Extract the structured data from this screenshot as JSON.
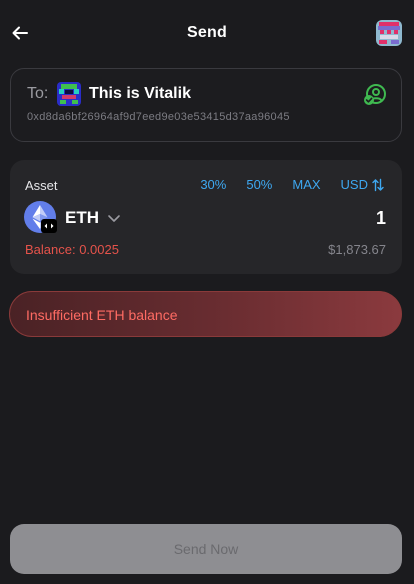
{
  "header": {
    "title": "Send",
    "back_icon": "arrow-left-icon",
    "avatar_icon": "wallet-avatar-icon"
  },
  "recipient": {
    "to_label": "To:",
    "name": "This is Vitalik",
    "address": "0xd8da6bf26964af9d7eed9e03e53415d37aa96045",
    "contact_icon": "contact-check-icon"
  },
  "asset": {
    "label": "Asset",
    "percent_options": [
      "30%",
      "50%",
      "MAX"
    ],
    "currency": "USD",
    "token_symbol": "ETH",
    "amount": "1",
    "balance": "Balance: 0.0025",
    "fiat_value": "$1,873.67"
  },
  "error": {
    "message": "Insufficient ETH balance"
  },
  "footer": {
    "send_label": "Send Now"
  },
  "colors": {
    "background": "#1b1b1e",
    "accent": "#3ea8f1",
    "error": "#e5534b",
    "contact_icon": "#3fb950"
  }
}
